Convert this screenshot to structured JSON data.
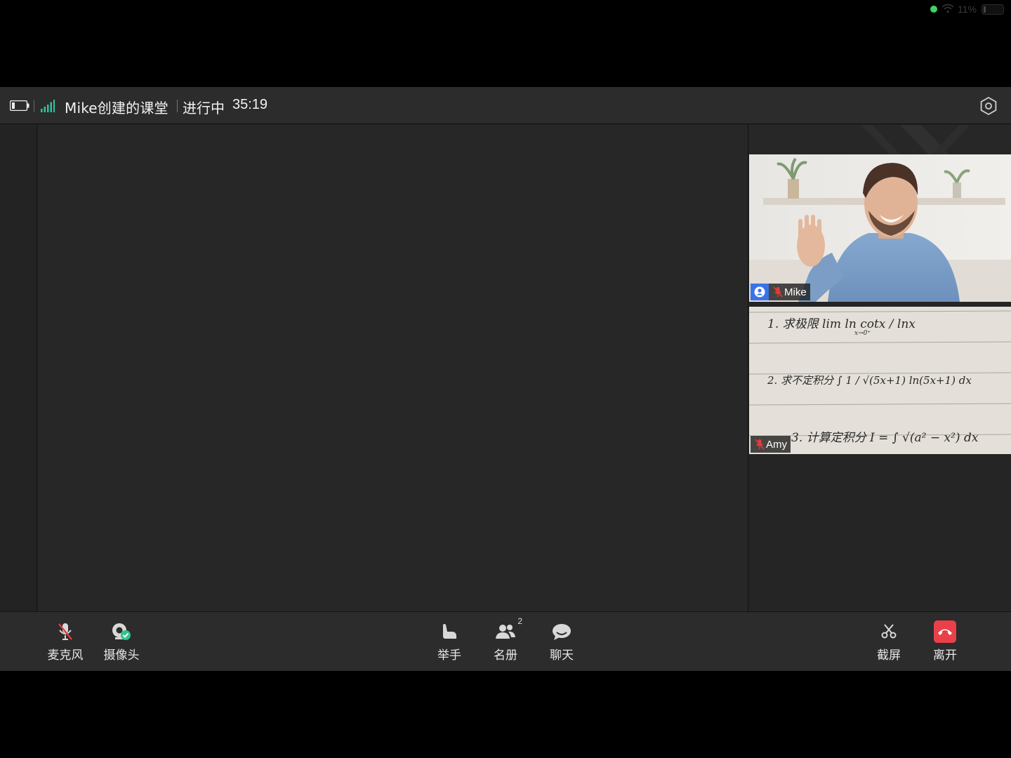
{
  "device_status": {
    "battery_percent": "11%"
  },
  "header": {
    "room_title": "Mike创建的课堂",
    "status": "进行中",
    "elapsed": "35:19"
  },
  "participants": [
    {
      "name": "Mike",
      "role": "host",
      "mic": "muted"
    },
    {
      "name": "Amy",
      "role": "student",
      "mic": "muted"
    }
  ],
  "toolbar": {
    "left": [
      {
        "id": "mic",
        "label": "麦克风",
        "icon": "mic-off-icon"
      },
      {
        "id": "camera",
        "label": "摄像头",
        "icon": "camera-on-icon"
      }
    ],
    "center": [
      {
        "id": "raise-hand",
        "label": "举手",
        "icon": "hand-icon"
      },
      {
        "id": "roster",
        "label": "名册",
        "icon": "people-icon",
        "count": "2"
      },
      {
        "id": "chat",
        "label": "聊天",
        "icon": "chat-icon"
      }
    ],
    "right": [
      {
        "id": "screenshot",
        "label": "截屏",
        "icon": "scissors-icon"
      },
      {
        "id": "leave",
        "label": "离开",
        "icon": "hangup-icon"
      }
    ]
  },
  "colors": {
    "leave_button": "#e9404a",
    "host_badge": "#3a73e8",
    "mic_muted": "#e33b3b",
    "camera_ok": "#2fc48c",
    "signal": "#2fc4a0"
  },
  "amy_board": {
    "line1": "1. 求极限 lim ln cotx / lnx",
    "line1_sub": "x→0⁺",
    "line2": "2. 求不定积分 ∫ 1 / √(5x+1) ln(5x+1) dx",
    "line3": "3. 计算定积分 I = ∫ √(a² − x²) dx"
  }
}
